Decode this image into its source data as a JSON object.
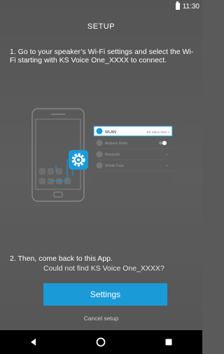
{
  "status_bar": {
    "time": "11:30"
  },
  "header": {
    "title": "SETUP"
  },
  "step1": {
    "text": "1. Go to your speaker’s Wi-Fi settings and select the Wi-Fi starting with KS Voice One_XXXX to connect."
  },
  "illustration": {
    "settings_rows": [
      {
        "label": "WLAN",
        "value": "KS Voice One >",
        "highlighted": true
      },
      {
        "label": "Airplane Mode",
        "value": "",
        "highlighted": false
      },
      {
        "label": "Bluetooth",
        "value": ">",
        "highlighted": false
      },
      {
        "label": "Mobile Data",
        "value": ">",
        "highlighted": false
      }
    ],
    "accent_color": "#1b9ad8"
  },
  "step2": {
    "text": "2. Then, come back to this App."
  },
  "help": {
    "not_found": "Could not find KS Voice One_XXXX?"
  },
  "actions": {
    "settings_label": "Settings",
    "cancel_label": "Cancel setup"
  },
  "nav": {
    "back": "back-icon",
    "home": "home-icon",
    "recents": "recents-icon"
  }
}
